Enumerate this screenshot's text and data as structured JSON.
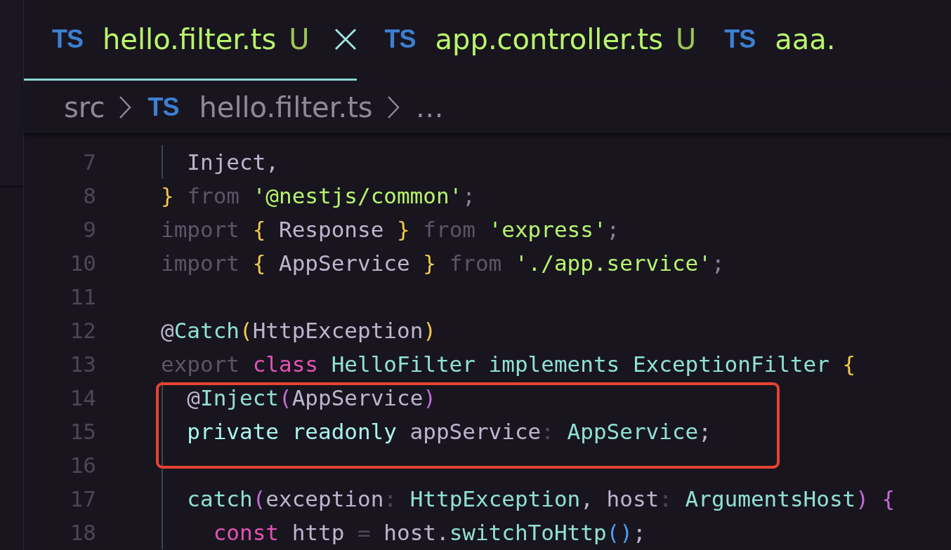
{
  "tabs": [
    {
      "file_icon": "TS",
      "label": "hello.filter.ts",
      "status": "U",
      "selected": true
    },
    {
      "file_icon": "TS",
      "label": "app.controller.ts",
      "status": "U",
      "selected": false
    },
    {
      "file_icon": "TS",
      "label": "aaa.",
      "selected": false
    }
  ],
  "breadcrumbs": [
    {
      "label": "src"
    },
    {
      "file_icon": "TS",
      "label": "hello.filter.ts"
    },
    {
      "label": "…"
    }
  ],
  "editor": {
    "lines": [
      {
        "number": "7",
        "boxed": false,
        "tokens": [
          {
            "text": "  Inject,",
            "kind": "ident"
          }
        ]
      },
      {
        "number": "8",
        "boxed": false,
        "tokens": [
          {
            "text": "}",
            "kind": "bracket1"
          },
          {
            "text": " from ",
            "kind": "muted"
          },
          {
            "text": "'@nestjs/common'",
            "kind": "string"
          },
          {
            "text": ";",
            "kind": "punct"
          }
        ]
      },
      {
        "number": "9",
        "boxed": false,
        "tokens": [
          {
            "text": "import ",
            "kind": "muted"
          },
          {
            "text": "{",
            "kind": "bracket1"
          },
          {
            "text": " Response ",
            "kind": "ident"
          },
          {
            "text": "}",
            "kind": "bracket1"
          },
          {
            "text": " from ",
            "kind": "muted"
          },
          {
            "text": "'express'",
            "kind": "string"
          },
          {
            "text": ";",
            "kind": "punct"
          }
        ]
      },
      {
        "number": "10",
        "boxed": false,
        "tokens": [
          {
            "text": "import ",
            "kind": "muted"
          },
          {
            "text": "{",
            "kind": "bracket1"
          },
          {
            "text": " AppService ",
            "kind": "ident"
          },
          {
            "text": "}",
            "kind": "bracket1"
          },
          {
            "text": " from ",
            "kind": "muted"
          },
          {
            "text": "'./app.service'",
            "kind": "string"
          },
          {
            "text": ";",
            "kind": "punct"
          }
        ]
      },
      {
        "number": "11",
        "boxed": false
      },
      {
        "number": "12",
        "boxed": false,
        "tokens": [
          {
            "text": "@",
            "kind": "ident"
          },
          {
            "text": "Catch",
            "kind": "name"
          },
          {
            "text": "(",
            "kind": "bracket1"
          },
          {
            "text": "HttpException",
            "kind": "ident"
          },
          {
            "text": ")",
            "kind": "bracket1"
          }
        ]
      },
      {
        "number": "13",
        "boxed": false,
        "tokens": [
          {
            "text": "export ",
            "kind": "muted"
          },
          {
            "text": "class ",
            "kind": "keyword"
          },
          {
            "text": "HelloFilter implements ExceptionFilter ",
            "kind": "name"
          },
          {
            "text": "{",
            "kind": "bracket1"
          }
        ]
      },
      {
        "number": "14",
        "boxed": true,
        "tokens": [
          {
            "text": "  @",
            "kind": "ident"
          },
          {
            "text": "Inject",
            "kind": "name"
          },
          {
            "text": "(",
            "kind": "bracket2"
          },
          {
            "text": "AppService",
            "kind": "ident"
          },
          {
            "text": ")",
            "kind": "bracket2"
          }
        ]
      },
      {
        "number": "15",
        "boxed": true,
        "tokens": [
          {
            "text": "  private readonly ",
            "kind": "modifier"
          },
          {
            "text": "appService",
            "kind": "ident"
          },
          {
            "text": ":",
            "kind": "operator"
          },
          {
            "text": " AppService",
            "kind": "name"
          },
          {
            "text": ";",
            "kind": "ident"
          }
        ]
      },
      {
        "number": "16",
        "boxed": true
      },
      {
        "number": "17",
        "boxed": false,
        "tokens": [
          {
            "text": "  catch",
            "kind": "name"
          },
          {
            "text": "(",
            "kind": "bracket2"
          },
          {
            "text": "exception",
            "kind": "ident"
          },
          {
            "text": ":",
            "kind": "operator"
          },
          {
            "text": " HttpException",
            "kind": "name"
          },
          {
            "text": ", host",
            "kind": "ident"
          },
          {
            "text": ":",
            "kind": "operator"
          },
          {
            "text": " ArgumentsHost",
            "kind": "name"
          },
          {
            "text": ")",
            "kind": "bracket2"
          },
          {
            "text": " {",
            "kind": "bracket2"
          }
        ]
      },
      {
        "number": "18",
        "boxed": false,
        "tokens": [
          {
            "text": "    const ",
            "kind": "keyword"
          },
          {
            "text": "http ",
            "kind": "ident"
          },
          {
            "text": "=",
            "kind": "operator"
          },
          {
            "text": " host.",
            "kind": "ident"
          },
          {
            "text": "switchToHttp",
            "kind": "name"
          },
          {
            "text": "()",
            "kind": "bracket3"
          },
          {
            "text": ";",
            "kind": "ident"
          }
        ]
      }
    ]
  }
}
